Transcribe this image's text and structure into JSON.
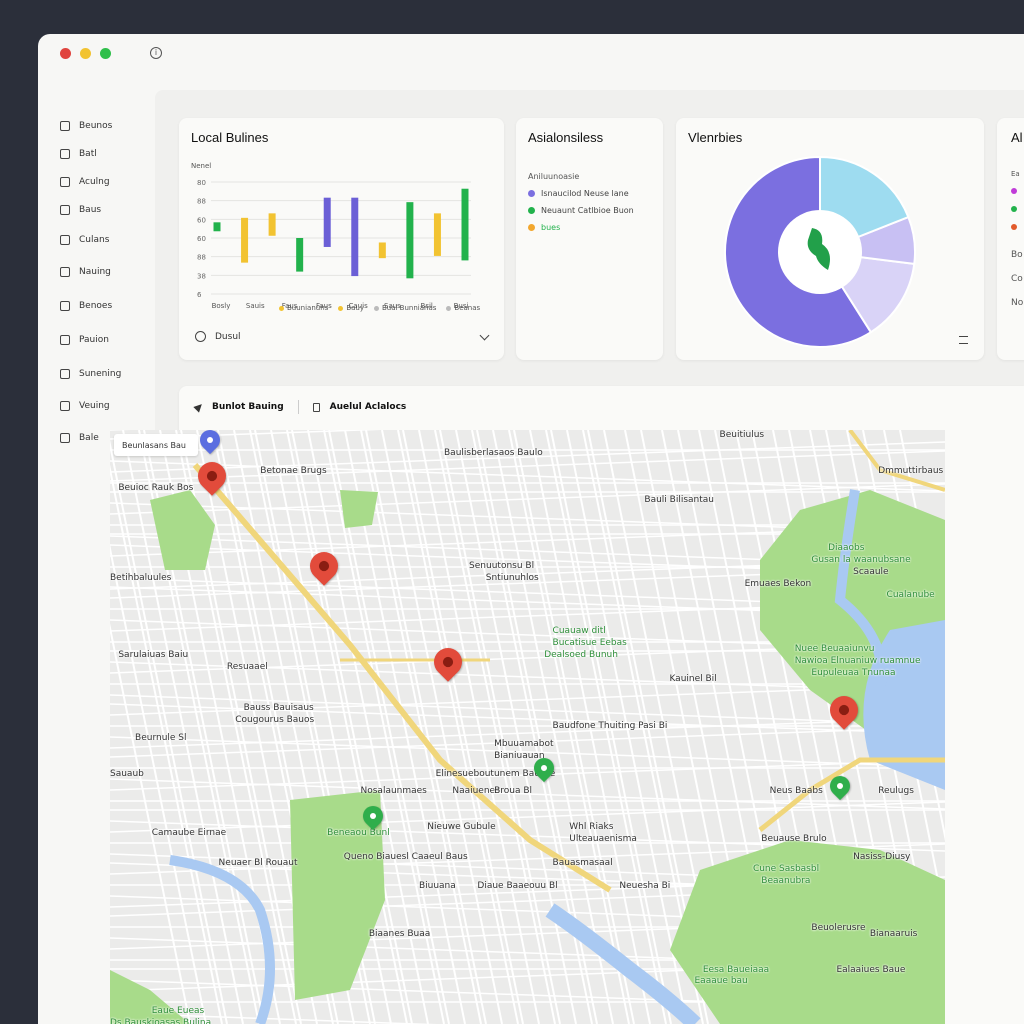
{
  "window": {
    "controls": {
      "close": "#e0443e",
      "minimize": "#f2c331",
      "maximize": "#2fbf4a"
    },
    "info_icon": "i"
  },
  "sidebar": {
    "items": [
      {
        "label": "Beunos",
        "icon": "folder-icon"
      },
      {
        "label": "Batl",
        "icon": "grid-icon"
      },
      {
        "label": "Aculng",
        "icon": "chat-icon"
      },
      {
        "label": "Baus",
        "icon": "bus-icon"
      },
      {
        "label": "Culans",
        "icon": "box-icon"
      },
      {
        "label": "Nauing",
        "icon": "tag-icon"
      },
      {
        "label": "Benoes",
        "icon": "doc-icon"
      },
      {
        "label": "Pauion",
        "icon": "list-icon"
      },
      {
        "label": "Sunening",
        "icon": "pin-icon"
      },
      {
        "label": "Veuing",
        "icon": "calendar-icon"
      },
      {
        "label": "Bale",
        "icon": "table-icon"
      }
    ]
  },
  "cards": {
    "local": {
      "title": "Local Bulines",
      "axis_title": "Nenel",
      "footer_label": "Dusul",
      "legend": [
        "Buunianuns",
        "Bauy",
        "Bual Bunnianas",
        "Beanas"
      ]
    },
    "asia": {
      "title": "Asialonsiless",
      "subtitle": "Aniluunoasie",
      "legend": [
        {
          "label": "Isnaucilod Neuse lane",
          "color": "#7b6fe0"
        },
        {
          "label": "Neuaunt Catlbioe Buon",
          "color": "#22b24c"
        },
        {
          "label": "bues",
          "color": "#f2a72e"
        }
      ]
    },
    "vienties": {
      "title": "Vlenrbies"
    },
    "fourth": {
      "title": "Al",
      "rows": [
        "Ea",
        "",
        "",
        "",
        "Bo",
        "Co",
        "No"
      ]
    }
  },
  "chart_data": [
    {
      "type": "bar",
      "title": "Local Bulines",
      "ylabel": "Nenel",
      "categories": [
        "Bosly",
        "Sauis",
        "Faus",
        "Faus",
        "Cauis",
        "Saus",
        "Bsil",
        "Busi"
      ],
      "y_ticks": [
        "80",
        "88",
        "60",
        "60",
        "88",
        "38",
        "6"
      ],
      "bars": [
        {
          "color": "#22b24c",
          "from": 56,
          "to": 64
        },
        {
          "color": "#f2c331",
          "from": 28,
          "to": 68
        },
        {
          "color": "#f2c331",
          "from": 52,
          "to": 72
        },
        {
          "color": "#22b24c",
          "from": 20,
          "to": 50
        },
        {
          "color": "#6b5fd6",
          "from": 42,
          "to": 86
        },
        {
          "color": "#6b5fd6",
          "from": 16,
          "to": 86
        },
        {
          "color": "#f2c331",
          "from": 32,
          "to": 46
        },
        {
          "color": "#22b24c",
          "from": 14,
          "to": 82
        },
        {
          "color": "#f2c331",
          "from": 34,
          "to": 72
        },
        {
          "color": "#22b24c",
          "from": 30,
          "to": 94
        }
      ],
      "ylim": [
        0,
        100
      ]
    },
    {
      "type": "pie",
      "title": "Vlenrbies",
      "slices": [
        {
          "value": 59,
          "color": "#7b6fe0"
        },
        {
          "value": 14,
          "color": "#d9d3f7"
        },
        {
          "value": 8,
          "color": "#c8c0f3"
        },
        {
          "value": 19,
          "color": "#9edcf0"
        }
      ]
    }
  ],
  "map_panel": {
    "tabs": [
      {
        "label": "Bunlot Bauing",
        "icon": "navigation-icon"
      },
      {
        "label": "Auelul Aclalocs",
        "icon": "bookmark-icon"
      }
    ],
    "search_value": "Beunlasans Bau",
    "labels": [
      {
        "t": "Betonae Brugs",
        "x": 18,
        "y": 6,
        "g": false
      },
      {
        "t": "Baulisberlasaos Baulo",
        "x": 40,
        "y": 3,
        "g": false
      },
      {
        "t": "Beuitiulus",
        "x": 73,
        "y": 0,
        "g": false
      },
      {
        "t": "Beuioc Rauk Bos",
        "x": 1,
        "y": 9,
        "g": false
      },
      {
        "t": "Bauli Bilisantau",
        "x": 64,
        "y": 11,
        "g": false
      },
      {
        "t": "Dmmuttirbaus",
        "x": 92,
        "y": 6,
        "g": false
      },
      {
        "t": "Senuutonsu Bl",
        "x": 43,
        "y": 22,
        "g": false
      },
      {
        "t": "Sntiunuhlos",
        "x": 45,
        "y": 24,
        "g": false
      },
      {
        "t": "Betihbaluules",
        "x": 0,
        "y": 24,
        "g": false
      },
      {
        "t": "Emuaes Bekon",
        "x": 76,
        "y": 25,
        "g": false
      },
      {
        "t": "Diaaobs",
        "x": 86,
        "y": 19,
        "g": true
      },
      {
        "t": "Gusan la waanubsane",
        "x": 84,
        "y": 21,
        "g": true
      },
      {
        "t": "Scaaule",
        "x": 89,
        "y": 23,
        "g": false
      },
      {
        "t": "Cualanube",
        "x": 93,
        "y": 27,
        "g": true
      },
      {
        "t": "Cuauaw ditl",
        "x": 53,
        "y": 33,
        "g": true
      },
      {
        "t": "Bucatisue Eebas",
        "x": 53,
        "y": 35,
        "g": true
      },
      {
        "t": "Dealsoed Bunuh",
        "x": 52,
        "y": 37,
        "g": true
      },
      {
        "t": "Sarulaiuas Baiu",
        "x": 1,
        "y": 37,
        "g": false
      },
      {
        "t": "Resuaael",
        "x": 14,
        "y": 39,
        "g": false
      },
      {
        "t": "Nuee Beuaaiunvu",
        "x": 82,
        "y": 36,
        "g": true
      },
      {
        "t": "Nawioa Elnuaniuw ruamnue",
        "x": 82,
        "y": 38,
        "g": true
      },
      {
        "t": "Eupuleuaa Tnunaa",
        "x": 84,
        "y": 40,
        "g": true
      },
      {
        "t": "Kauinel Bil",
        "x": 67,
        "y": 41,
        "g": false
      },
      {
        "t": "Bauss Bauisaus",
        "x": 16,
        "y": 46,
        "g": false
      },
      {
        "t": "Cougourus Bauos",
        "x": 15,
        "y": 48,
        "g": false
      },
      {
        "t": "Baudfone Thuiting Pasi Bi",
        "x": 53,
        "y": 49,
        "g": false
      },
      {
        "t": "Beurnule Sl",
        "x": 3,
        "y": 51,
        "g": false
      },
      {
        "t": "Mbuuamabot",
        "x": 46,
        "y": 52,
        "g": false
      },
      {
        "t": "Bianiuauan",
        "x": 46,
        "y": 54,
        "g": false
      },
      {
        "t": "Sauaub",
        "x": 0,
        "y": 57,
        "g": false
      },
      {
        "t": "Elinesueboutunem Bauiwe",
        "x": 39,
        "y": 57,
        "g": false
      },
      {
        "t": "Nosalaunmaes",
        "x": 30,
        "y": 60,
        "g": false
      },
      {
        "t": "Naaiuenes",
        "x": 41,
        "y": 60,
        "g": false
      },
      {
        "t": "Broua Bl",
        "x": 46,
        "y": 60,
        "g": false
      },
      {
        "t": "Neus Baabs",
        "x": 79,
        "y": 60,
        "g": false
      },
      {
        "t": "Reulugs",
        "x": 92,
        "y": 60,
        "g": false
      },
      {
        "t": "Camaube Eirnae",
        "x": 5,
        "y": 67,
        "g": false
      },
      {
        "t": "Beneaou Bunl",
        "x": 26,
        "y": 67,
        "g": true
      },
      {
        "t": "Nieuwe Gubule",
        "x": 38,
        "y": 66,
        "g": false
      },
      {
        "t": "Whl Riaks",
        "x": 55,
        "y": 66,
        "g": false
      },
      {
        "t": "Ulteauaenisma",
        "x": 55,
        "y": 68,
        "g": false
      },
      {
        "t": "Beuause Brulo",
        "x": 78,
        "y": 68,
        "g": false
      },
      {
        "t": "Neuaer Bl Rouaut",
        "x": 13,
        "y": 72,
        "g": false
      },
      {
        "t": "Queno Biauesl Caaeul Baus",
        "x": 28,
        "y": 71,
        "g": false
      },
      {
        "t": "Bauasmasaal",
        "x": 53,
        "y": 72,
        "g": false
      },
      {
        "t": "Nasiss-Diusy",
        "x": 89,
        "y": 71,
        "g": false
      },
      {
        "t": "Biuuana",
        "x": 37,
        "y": 76,
        "g": false
      },
      {
        "t": "Diaue Baaeouu Bl",
        "x": 44,
        "y": 76,
        "g": false
      },
      {
        "t": "Neuesha Bi",
        "x": 61,
        "y": 76,
        "g": false
      },
      {
        "t": "Cune Sasbasbl",
        "x": 77,
        "y": 73,
        "g": true
      },
      {
        "t": "Beaanubra",
        "x": 78,
        "y": 75,
        "g": true
      },
      {
        "t": "Biaanes Buaa",
        "x": 31,
        "y": 84,
        "g": false
      },
      {
        "t": "Beuolerusre",
        "x": 84,
        "y": 83,
        "g": false
      },
      {
        "t": "Bianaaruis",
        "x": 91,
        "y": 84,
        "g": false
      },
      {
        "t": "Ealaaiues Baue",
        "x": 87,
        "y": 90,
        "g": false
      },
      {
        "t": "Eesa Baueiaaa",
        "x": 71,
        "y": 90,
        "g": true
      },
      {
        "t": "Eaaaue bau",
        "x": 70,
        "y": 92,
        "g": true
      },
      {
        "t": "Eaue Eueas",
        "x": 5,
        "y": 97,
        "g": true
      },
      {
        "t": "Ds Bauskioasas Bulina",
        "x": 0,
        "y": 99,
        "g": true
      }
    ]
  }
}
